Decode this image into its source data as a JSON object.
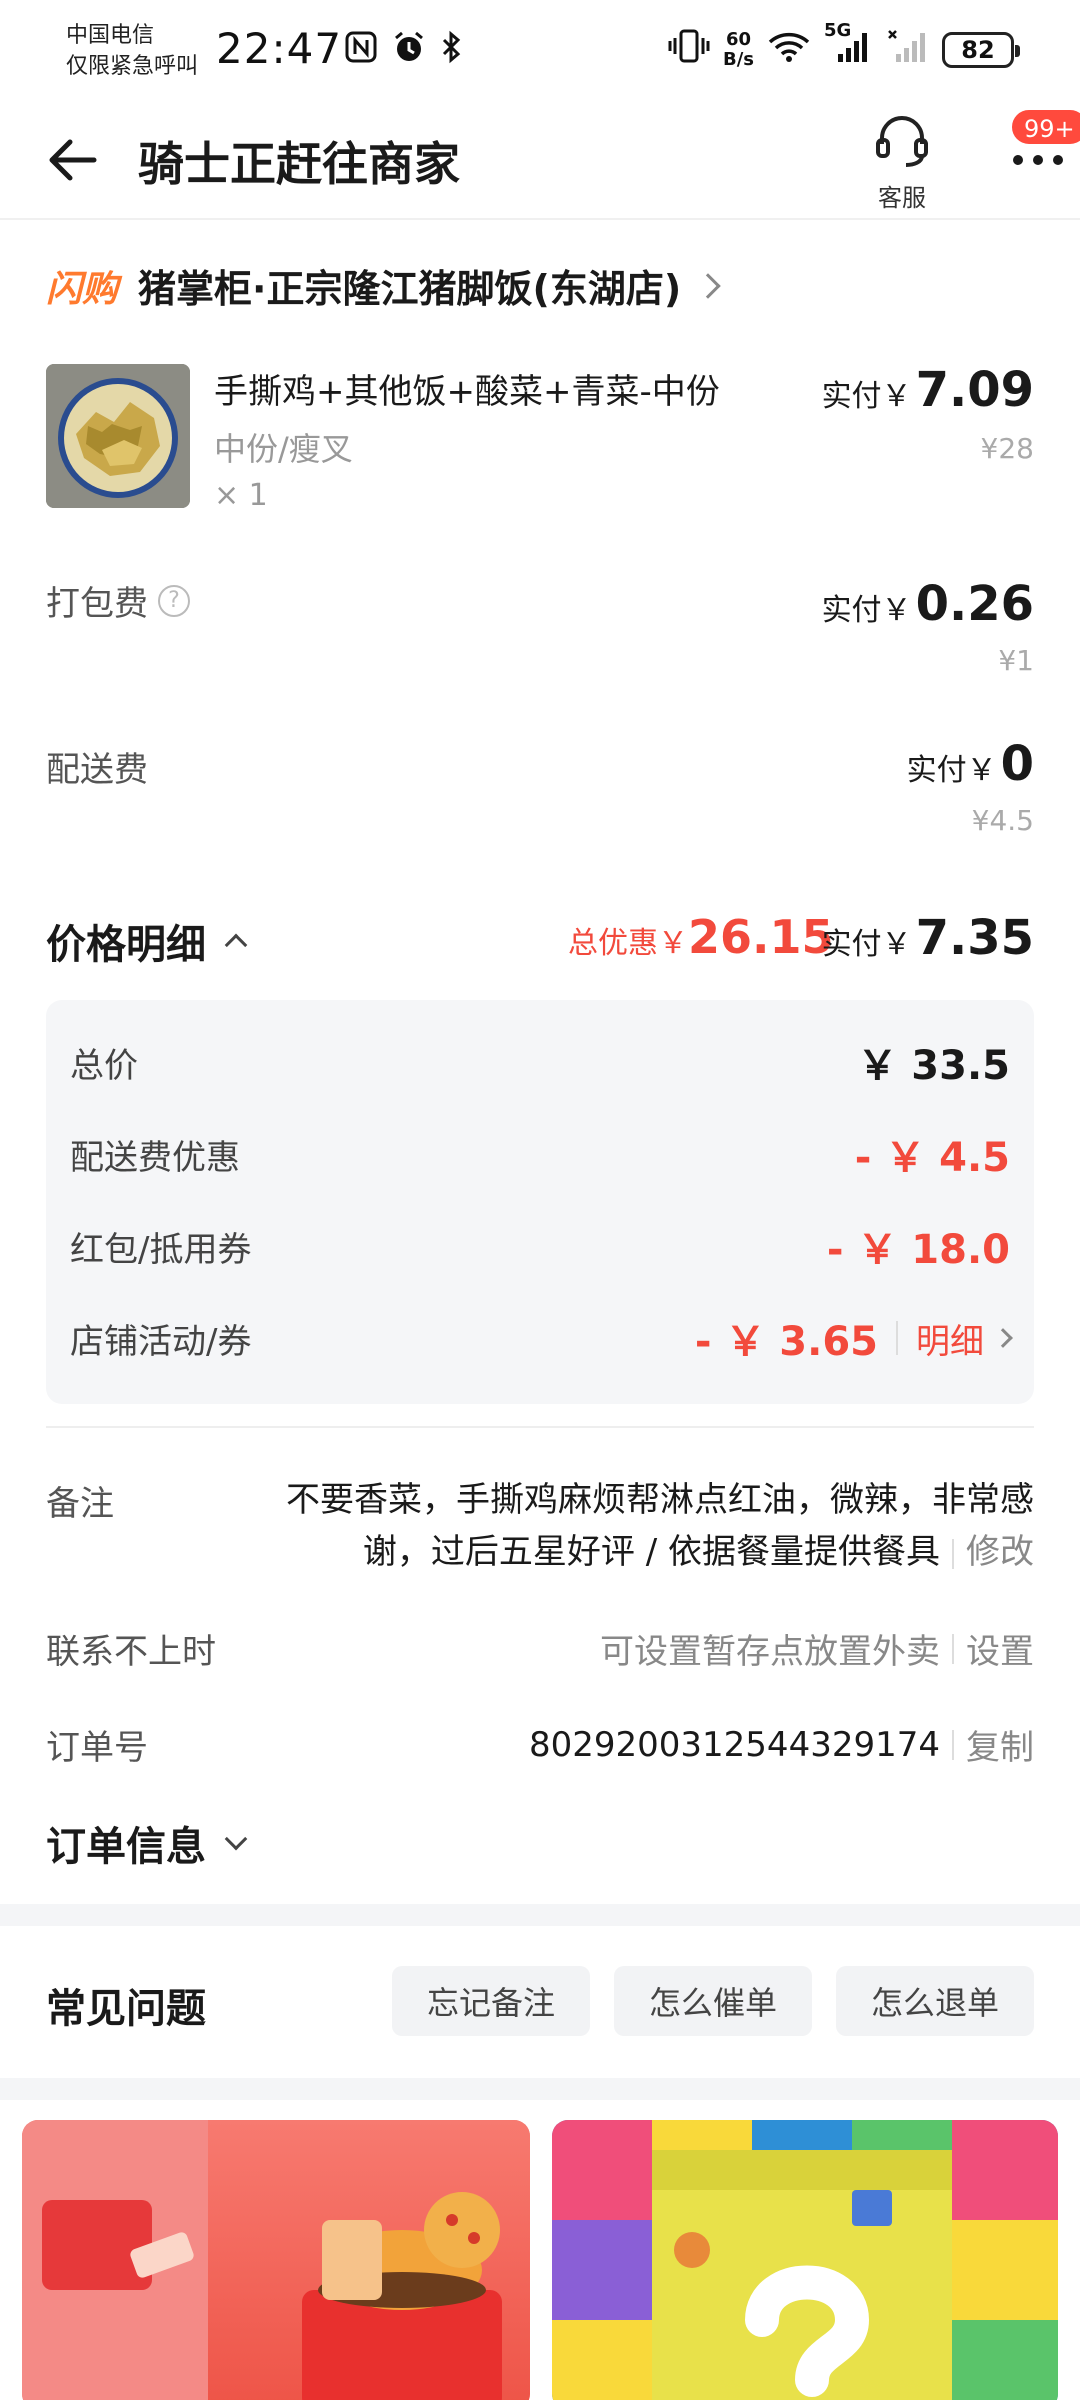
{
  "status_bar": {
    "carrier_line1": "中国电信",
    "carrier_line2": "仅限紧急呼叫",
    "time": "22:47",
    "net_speed_value": "60",
    "net_speed_unit": "B/s",
    "network": "5G",
    "battery": "82"
  },
  "header": {
    "title": "骑士正赶往商家",
    "service_label": "客服",
    "badge": "99+"
  },
  "store": {
    "tag": "闪购",
    "name": "猪掌柜·正宗隆江猪脚饭(东湖店)"
  },
  "item": {
    "name": "手撕鸡+其他饭+酸菜+青菜-中份",
    "spec": "中份/瘦叉",
    "qty": "× 1",
    "paid_prefix": "实付￥",
    "paid": "7.09",
    "original": "¥28"
  },
  "packing_fee": {
    "label": "打包费",
    "paid_prefix": "实付￥",
    "paid": "0.26",
    "original": "¥1"
  },
  "delivery_fee": {
    "label": "配送费",
    "paid_prefix": "实付￥",
    "paid": "0",
    "original": "¥4.5"
  },
  "price_detail": {
    "title": "价格明细",
    "discount_prefix": "总优惠￥",
    "discount": "26.15",
    "paid_prefix": "实付￥",
    "paid": "7.35",
    "rows": [
      {
        "label": "总价",
        "value": "￥ 33.5"
      },
      {
        "label": "配送费优惠",
        "value": "- ￥ 4.5"
      },
      {
        "label": "红包/抵用券",
        "value": "- ￥ 18.0"
      },
      {
        "label": "店铺活动/券",
        "value": "- ￥ 3.65",
        "link": "明细"
      }
    ]
  },
  "note": {
    "label": "备注",
    "line1": "不要香菜，手撕鸡麻烦帮淋点红油，微辣，非常感",
    "line2": "谢，过后五星好评 / 依据餐量提供餐具",
    "action": "修改"
  },
  "unreachable": {
    "label": "联系不上时",
    "value": "可设置暂存点放置外卖",
    "action": "设置"
  },
  "order_no": {
    "label": "订单号",
    "value": "8029200312544329174",
    "action": "复制"
  },
  "order_info": {
    "title": "订单信息"
  },
  "faq": {
    "title": "常见问题",
    "chips": [
      "忘记备注",
      "怎么催单",
      "怎么退单"
    ]
  },
  "colors": {
    "accent_red": "#f24a3c",
    "flash_orange": "#ff7a2e",
    "panel_bg": "#f5f6f8"
  }
}
